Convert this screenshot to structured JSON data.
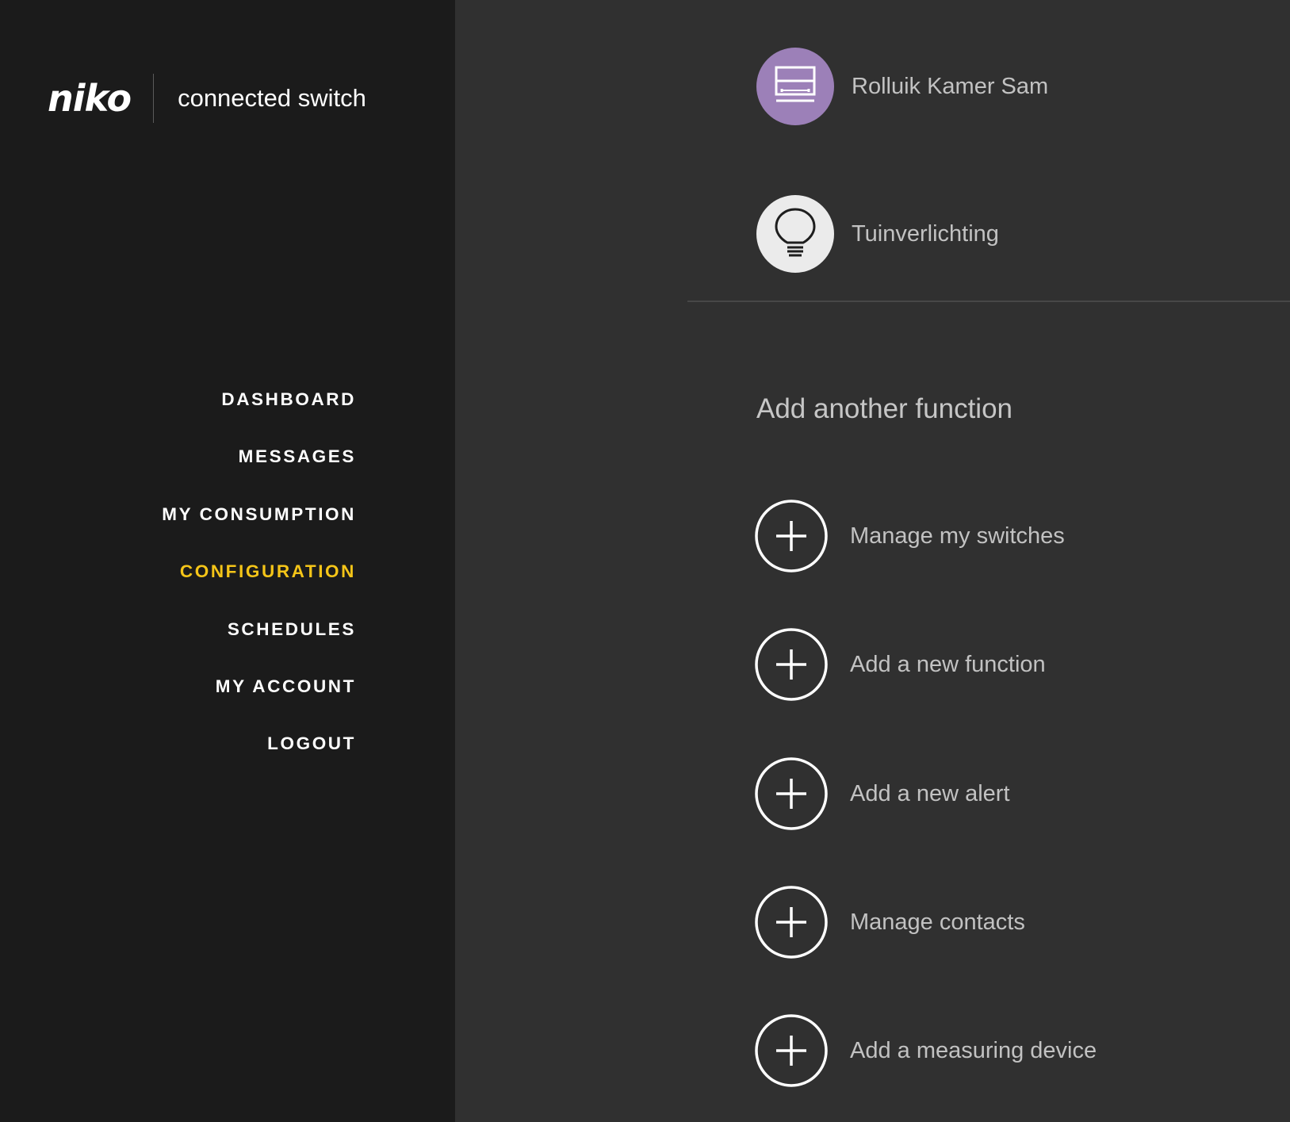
{
  "brand": {
    "logo": "niko",
    "product": "connected switch"
  },
  "nav": {
    "items": [
      {
        "label": "DASHBOARD",
        "active": false
      },
      {
        "label": "MESSAGES",
        "active": false
      },
      {
        "label": "MY CONSUMPTION",
        "active": false
      },
      {
        "label": "CONFIGURATION",
        "active": true
      },
      {
        "label": "SCHEDULES",
        "active": false
      },
      {
        "label": "MY ACCOUNT",
        "active": false
      },
      {
        "label": "LOGOUT",
        "active": false
      }
    ],
    "active_color": "#f5c518"
  },
  "functions": [
    {
      "label": "Rolluik Kamer Sam",
      "icon": "roller-shutter-icon",
      "icon_bg": "#9c80b8"
    },
    {
      "label": "Tuinverlichting",
      "icon": "light-bulb-icon",
      "icon_bg": "#ebebeb"
    }
  ],
  "add_section": {
    "title": "Add another function",
    "actions": [
      {
        "label": "Manage my switches",
        "icon": "plus-circle-icon"
      },
      {
        "label": "Add a new function",
        "icon": "plus-circle-icon"
      },
      {
        "label": "Add a new alert",
        "icon": "plus-circle-icon"
      },
      {
        "label": "Manage contacts",
        "icon": "plus-circle-icon"
      },
      {
        "label": "Add a measuring device",
        "icon": "plus-circle-icon"
      }
    ]
  }
}
